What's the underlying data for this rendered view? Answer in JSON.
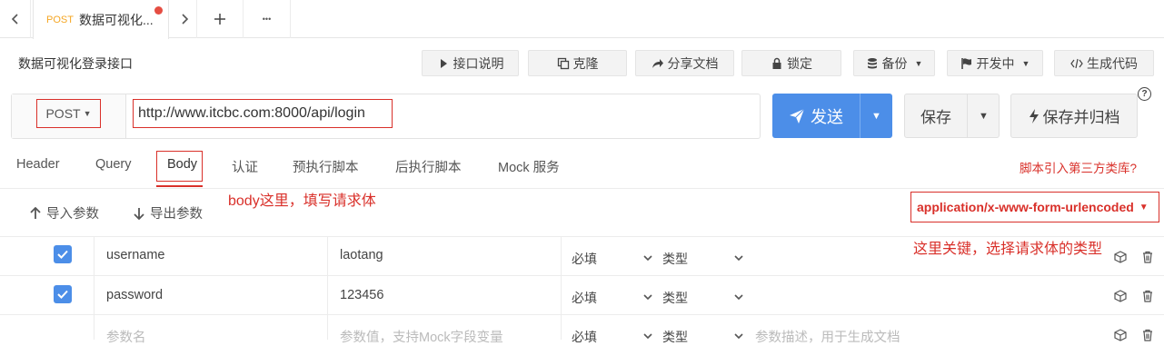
{
  "tab": {
    "method": "POST",
    "title": "数据可视化..."
  },
  "tab_more": "•••",
  "api_name": "数据可视化登录接口",
  "toolbar": {
    "doc": "接口说明",
    "clone": "克隆",
    "share": "分享文档",
    "lock": "锁定",
    "backup": "备份",
    "status": "开发中",
    "gencode": "生成代码"
  },
  "request": {
    "method": "POST",
    "url": "http://www.itcbc.com:8000/api/login"
  },
  "actions": {
    "send": "发送",
    "save": "保存",
    "save_archive": "保存并归档"
  },
  "subtabs": [
    "Header",
    "Query",
    "Body",
    "认证",
    "预执行脚本",
    "后执行脚本",
    "Mock 服务"
  ],
  "third_party": "脚本引入第三方类库?",
  "annotation_body": "body这里，填写请求体",
  "annotation_type": "这里关键，选择请求体的类型",
  "params": {
    "import": "导入参数",
    "export": "导出参数"
  },
  "content_type": "application/x-www-form-urlencoded",
  "rows": [
    {
      "checked": true,
      "name": "username",
      "value": "laotang",
      "required": "必填",
      "type": "类型",
      "desc": ""
    },
    {
      "checked": true,
      "name": "password",
      "value": "123456",
      "required": "必填",
      "type": "类型",
      "desc": ""
    }
  ],
  "placeholder_row": {
    "name": "参数名",
    "value": "参数值，支持Mock字段变量",
    "required": "必填",
    "type": "类型",
    "desc": "参数描述，用于生成文档"
  },
  "colors": {
    "accent": "#4c8ee8",
    "annotation": "#d9302a",
    "method": "#f5a623"
  }
}
